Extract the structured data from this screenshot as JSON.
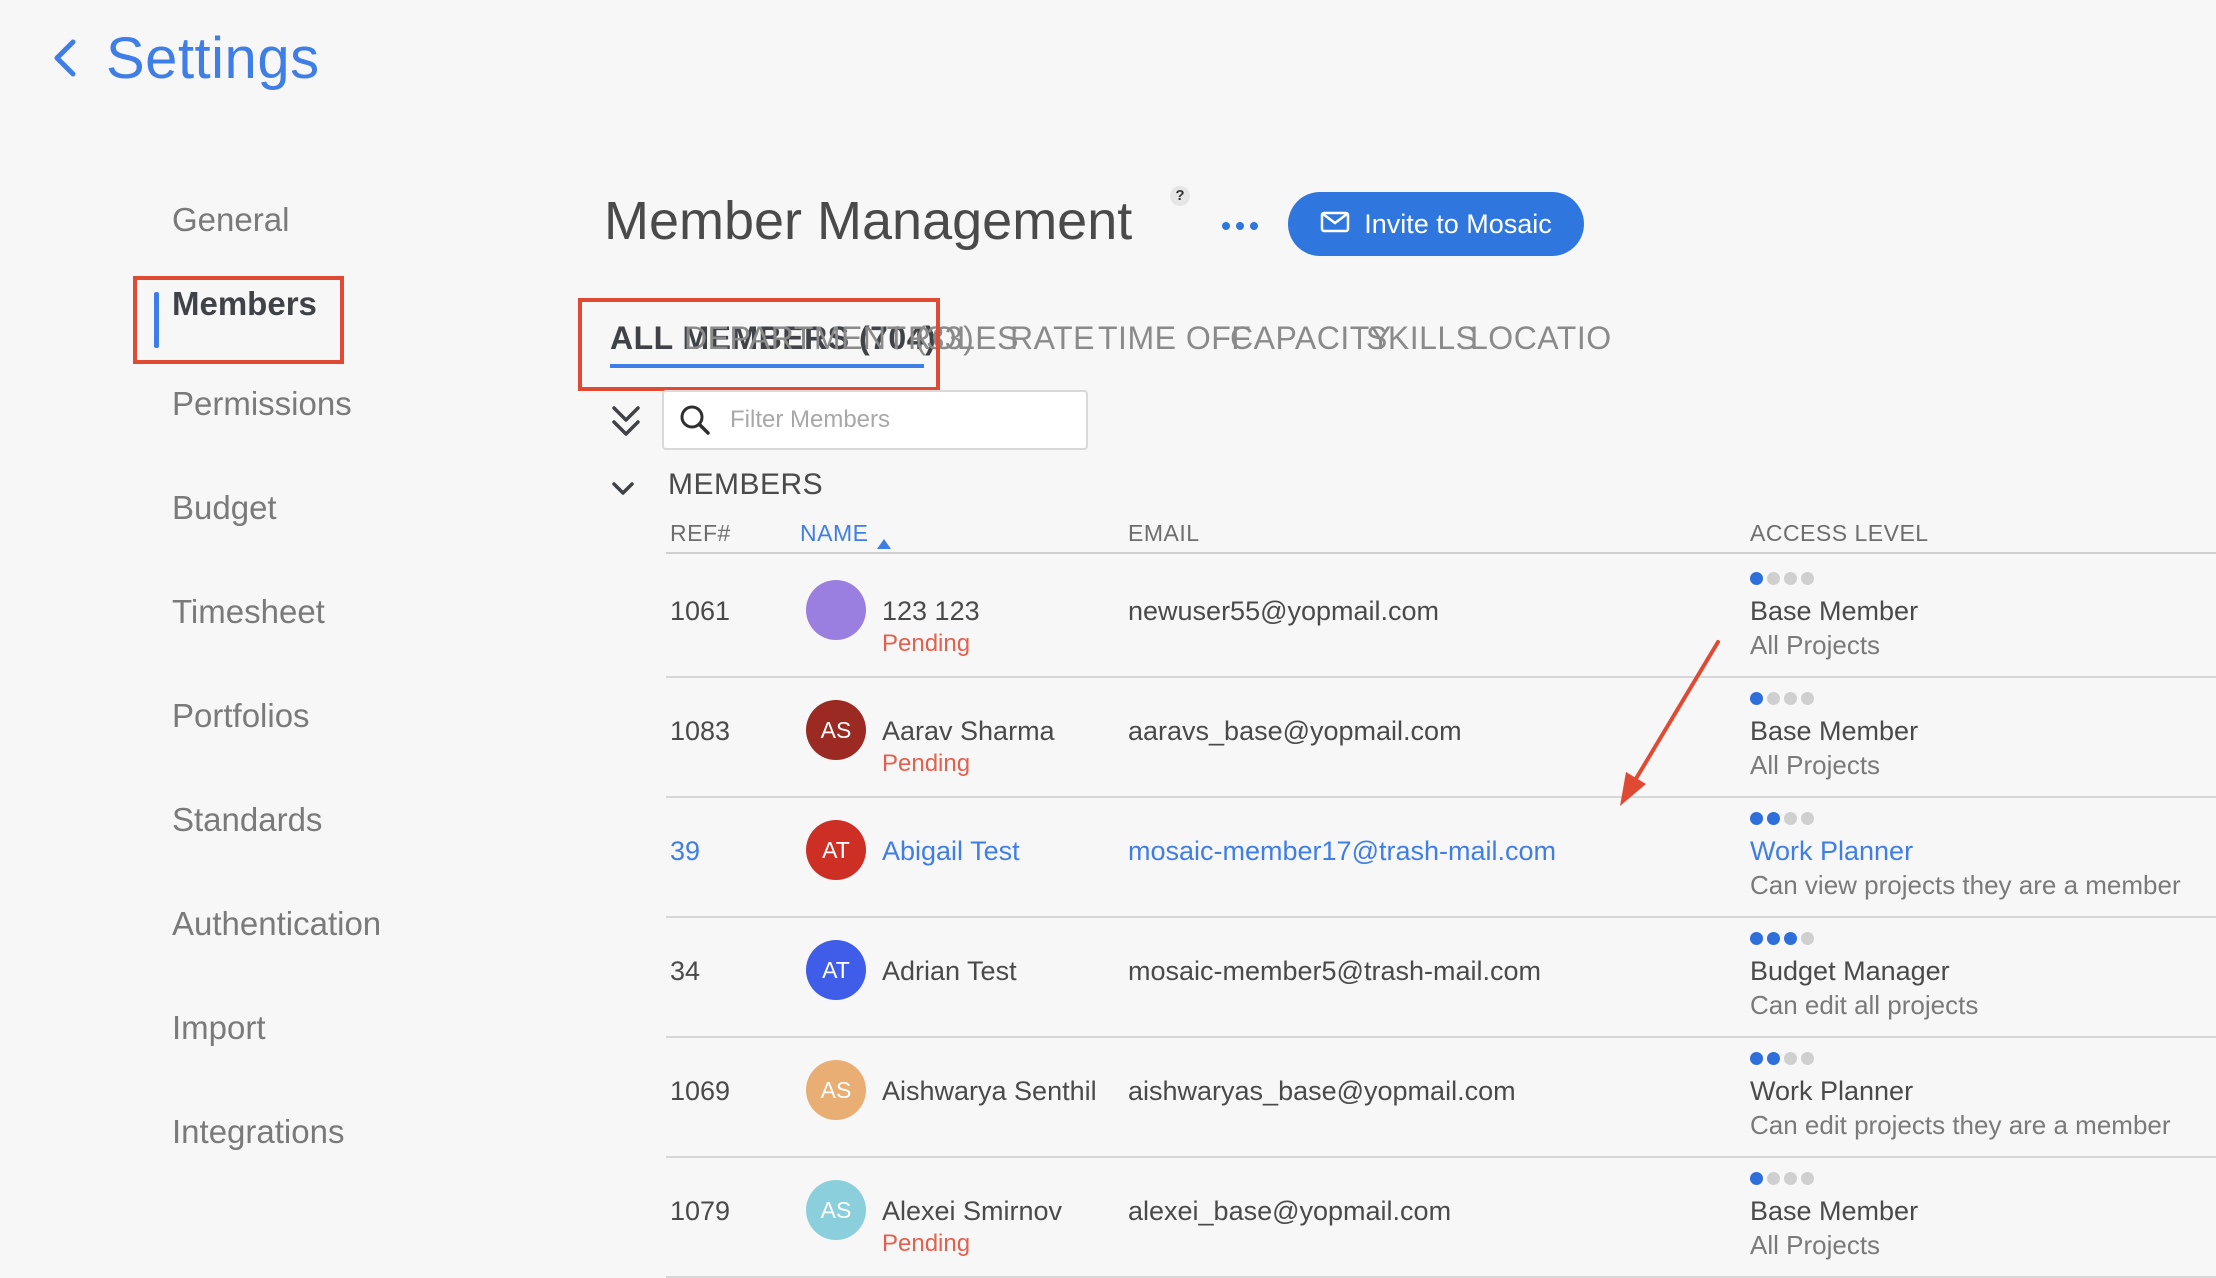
{
  "header": {
    "back_icon": "chevron-left-icon",
    "title": "Settings"
  },
  "sidebar": {
    "items": [
      {
        "label": "General"
      },
      {
        "label": "Members"
      },
      {
        "label": "Permissions"
      },
      {
        "label": "Budget"
      },
      {
        "label": "Timesheet"
      },
      {
        "label": "Portfolios"
      },
      {
        "label": "Standards"
      },
      {
        "label": "Authentication"
      },
      {
        "label": "Import"
      },
      {
        "label": "Integrations"
      }
    ],
    "active": "Members"
  },
  "page": {
    "title": "Member Management",
    "help_badge": "?",
    "more_icon": "more-horizontal-icon",
    "invite_button": "Invite to Mosaic",
    "invite_icon": "mail-icon"
  },
  "tabs": [
    {
      "label": "ALL MEMBERS (704)"
    },
    {
      "label": "DEPARTMENT (33)"
    },
    {
      "label": "ROLES"
    },
    {
      "label": "RATE"
    },
    {
      "label": "TIME OFF"
    },
    {
      "label": "CAPACITY"
    },
    {
      "label": "SKILLS"
    },
    {
      "label": "LOCATIO"
    }
  ],
  "filter": {
    "placeholder": "Filter Members",
    "value": ""
  },
  "group": {
    "label": "MEMBERS"
  },
  "columns": {
    "ref": "REF#",
    "name": "NAME",
    "email": "EMAIL",
    "access": "ACCESS LEVEL"
  },
  "colors": {
    "accent": "#3f7ee6",
    "button": "#2f77de",
    "pending": "#e2604e",
    "annotation": "#e04a32"
  },
  "rows": [
    {
      "ref": "1061",
      "initials": "",
      "avatar_color": "#9b7fe0",
      "name": "123 123",
      "status": "Pending",
      "email": "newuser55@yopmail.com",
      "access_dots": 1,
      "access": "Base Member",
      "access_sub": "All Projects"
    },
    {
      "ref": "1083",
      "initials": "AS",
      "avatar_color": "#9b2a22",
      "name": "Aarav Sharma",
      "status": "Pending",
      "email": "aaravs_base@yopmail.com",
      "access_dots": 1,
      "access": "Base Member",
      "access_sub": "All Projects"
    },
    {
      "ref": "39",
      "initials": "AT",
      "avatar_color": "#cd2f25",
      "name": "Abigail Test",
      "status": "",
      "email": "mosaic-member17@trash-mail.com",
      "access_dots": 2,
      "access": "Work Planner",
      "access_sub": "Can view projects they are a member"
    },
    {
      "ref": "34",
      "initials": "AT",
      "avatar_color": "#3f5de8",
      "name": "Adrian Test",
      "status": "",
      "email": "mosaic-member5@trash-mail.com",
      "access_dots": 3,
      "access": "Budget Manager",
      "access_sub": "Can edit all projects"
    },
    {
      "ref": "1069",
      "initials": "AS",
      "avatar_color": "#e8ae74",
      "name": "Aishwarya Senthil",
      "status": "",
      "email": "aishwaryas_base@yopmail.com",
      "access_dots": 2,
      "access": "Work Planner",
      "access_sub": "Can edit projects they are a member"
    },
    {
      "ref": "1079",
      "initials": "AS",
      "avatar_color": "#8ccfdc",
      "name": "Alexei Smirnov",
      "status": "Pending",
      "email": "alexei_base@yopmail.com",
      "access_dots": 1,
      "access": "Base Member",
      "access_sub": "All Projects"
    }
  ]
}
